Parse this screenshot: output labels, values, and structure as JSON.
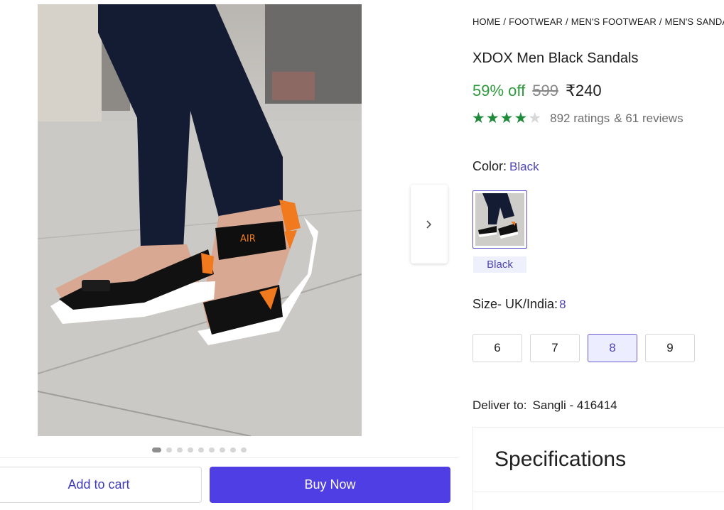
{
  "product_image": {
    "alt": "XDOX Men Black Sandals"
  },
  "carousel": {
    "dot_count": 9,
    "active_index": 0
  },
  "breadcrumb": [
    "HOME",
    "FOOTWEAR",
    "MEN'S FOOTWEAR",
    "MEN'S SANDALS"
  ],
  "breadcrumb_separator": "/",
  "product": {
    "title": "XDOX Men Black Sandals",
    "discount": "59% off",
    "mrp": "599",
    "price": "₹240",
    "rating_stars": 4,
    "ratings_text": "892 ratings",
    "reviews_text": "& 61 reviews"
  },
  "color": {
    "label": "Color:",
    "selected": "Black",
    "swatch_name": "Black"
  },
  "size": {
    "label": "Size- UK/India:",
    "selected": "8",
    "options": [
      "6",
      "7",
      "8",
      "9"
    ]
  },
  "delivery": {
    "label": "Deliver to:",
    "location": "Sangli - 416414"
  },
  "specifications": {
    "title": "Specifications"
  },
  "actions": {
    "add_to_cart": "Add to cart",
    "buy_now": "Buy Now"
  },
  "icons": {
    "next": "chevron-right-icon",
    "star": "star-icon"
  },
  "colors": {
    "accent": "#4f3ee3",
    "discount_green": "#2e9a3e",
    "star_green": "#1f8a3a",
    "link_purple": "#4e46b4"
  }
}
